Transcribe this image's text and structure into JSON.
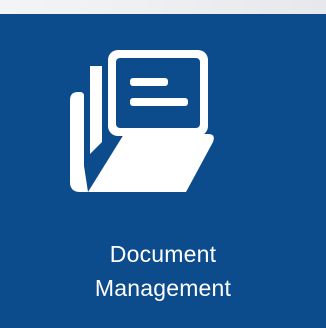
{
  "tile": {
    "label_line1": "Document",
    "label_line2": "Management",
    "icon": "folder-documents-icon",
    "background_color": "#0d4c8c",
    "foreground_color": "#ffffff"
  }
}
